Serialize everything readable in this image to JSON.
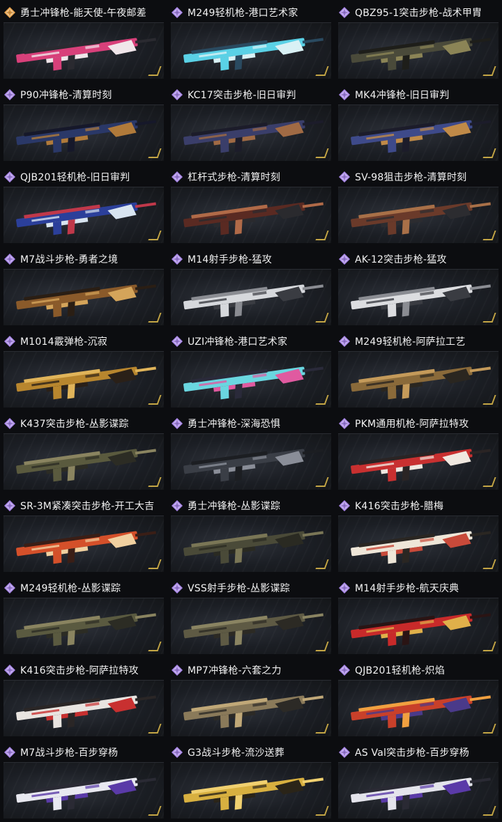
{
  "items": [
    {
      "title": "勇士冲锋枪-能天使-午夜邮差",
      "rarity": "orange",
      "skin": [
        "#d8407a",
        "#f0e6ea",
        "#2a2a30"
      ]
    },
    {
      "title": "M249轻机枪-港口艺术家",
      "rarity": "purple",
      "skin": [
        "#5ad1e6",
        "#d9f1f5",
        "#2a4a60"
      ]
    },
    {
      "title": "QBZ95-1突击步枪-战术甲胄",
      "rarity": "purple",
      "skin": [
        "#4a4a3a",
        "#8b8456",
        "#1e1e1a"
      ]
    },
    {
      "title": "P90冲锋枪-清算时刻",
      "rarity": "purple",
      "skin": [
        "#2a3868",
        "#b07a3a",
        "#16182a"
      ]
    },
    {
      "title": "KC17突击步枪-旧日审判",
      "rarity": "purple",
      "skin": [
        "#3a3e6a",
        "#a06a44",
        "#1c1c2a"
      ]
    },
    {
      "title": "MK4冲锋枪-旧日审判",
      "rarity": "purple",
      "skin": [
        "#3e4a8a",
        "#c08a48",
        "#1c1c2a"
      ]
    },
    {
      "title": "QJB201轻机枪-旧日审判",
      "rarity": "purple",
      "skin": [
        "#2b3f9a",
        "#d8e4f0",
        "#c0384a"
      ]
    },
    {
      "title": "杠杆式步枪-清算时刻",
      "rarity": "purple",
      "skin": [
        "#5a2a22",
        "#2a2a2e",
        "#b06a48"
      ]
    },
    {
      "title": "SV-98狙击步枪-清算时刻",
      "rarity": "purple",
      "skin": [
        "#6a3a2a",
        "#2c2c30",
        "#a87048"
      ]
    },
    {
      "title": "M7战斗步枪-勇者之境",
      "rarity": "purple",
      "skin": [
        "#8a5a2a",
        "#d4a45a",
        "#2a1e14"
      ]
    },
    {
      "title": "M14射手步枪-猛攻",
      "rarity": "purple",
      "skin": [
        "#d6d8dc",
        "#3a3c42",
        "#8a8c92"
      ]
    },
    {
      "title": "AK-12突击步枪-猛攻",
      "rarity": "purple",
      "skin": [
        "#dcdde0",
        "#3a3c42",
        "#8a8c92"
      ]
    },
    {
      "title": "M1014霰弹枪-沉寂",
      "rarity": "purple",
      "skin": [
        "#b8862e",
        "#2a2018",
        "#e0b45a"
      ]
    },
    {
      "title": "UZI冲锋枪-港口艺术家",
      "rarity": "purple",
      "skin": [
        "#6ad6e0",
        "#e05aa0",
        "#2a2a3a"
      ]
    },
    {
      "title": "M249轻机枪-阿萨拉工艺",
      "rarity": "purple",
      "skin": [
        "#8a6a3a",
        "#2a2620",
        "#c49a5a"
      ]
    },
    {
      "title": "K437突击步枪-丛影谍踪",
      "rarity": "purple",
      "skin": [
        "#5a5a3e",
        "#2c2c24",
        "#8a8460"
      ]
    },
    {
      "title": "勇士冲锋枪-深海恐惧",
      "rarity": "purple",
      "skin": [
        "#3a3e46",
        "#8a8e98",
        "#1c1e22"
      ]
    },
    {
      "title": "PKM通用机枪-阿萨拉特攻",
      "rarity": "purple",
      "skin": [
        "#c83030",
        "#f0e8e0",
        "#2a2424"
      ]
    },
    {
      "title": "SR-3M紧凑突击步枪-开工大吉",
      "rarity": "purple",
      "skin": [
        "#d4502a",
        "#f0d0a0",
        "#3a1e16"
      ]
    },
    {
      "title": "勇士冲锋枪-丛影谍踪",
      "rarity": "purple",
      "skin": [
        "#4a4a38",
        "#2a2a22",
        "#7a7656"
      ]
    },
    {
      "title": "K416突击步枪-腊梅",
      "rarity": "purple",
      "skin": [
        "#eee6d8",
        "#c84a3a",
        "#2a2622"
      ]
    },
    {
      "title": "M249轻机枪-丛影谍踪",
      "rarity": "purple",
      "skin": [
        "#5a5a40",
        "#2c2c24",
        "#8a8460"
      ]
    },
    {
      "title": "VSS射手步枪-丛影谍踪",
      "rarity": "purple",
      "skin": [
        "#5e5a44",
        "#2c2a24",
        "#8a8462"
      ]
    },
    {
      "title": "M14射手步枪-航天庆典",
      "rarity": "purple",
      "skin": [
        "#c82a2a",
        "#e0b04a",
        "#2a1414"
      ]
    },
    {
      "title": "K416突击步枪-阿萨拉特攻",
      "rarity": "purple",
      "skin": [
        "#e8e4e0",
        "#c83030",
        "#2a2626"
      ]
    },
    {
      "title": "MP7冲锋枪-六套之力",
      "rarity": "purple",
      "skin": [
        "#8a7a5a",
        "#2c2a26",
        "#c0a878"
      ]
    },
    {
      "title": "QJB201轻机枪-炽焰",
      "rarity": "purple",
      "skin": [
        "#c8402a",
        "#4a3a8a",
        "#f0a040"
      ]
    },
    {
      "title": "M7战斗步枪-百步穿杨",
      "rarity": "purple",
      "skin": [
        "#e8e8f0",
        "#5a3aa8",
        "#2a2a34"
      ]
    },
    {
      "title": "G3战斗步枪-流沙送葬",
      "rarity": "purple",
      "skin": [
        "#d8b040",
        "#2a2418",
        "#f0d070"
      ]
    },
    {
      "title": "AS Val突击步枪-百步穿杨",
      "rarity": "purple",
      "skin": [
        "#e4e4ec",
        "#5a3aa8",
        "#2a2a34"
      ]
    }
  ],
  "colors": {
    "purple": "#a886e8",
    "orange": "#e8a24a",
    "background": "#0c0d10",
    "text": "#f2f2f2"
  },
  "icons": {
    "rarity": "diamond-rarity-icon",
    "corner": "tier-chevron-icon"
  }
}
